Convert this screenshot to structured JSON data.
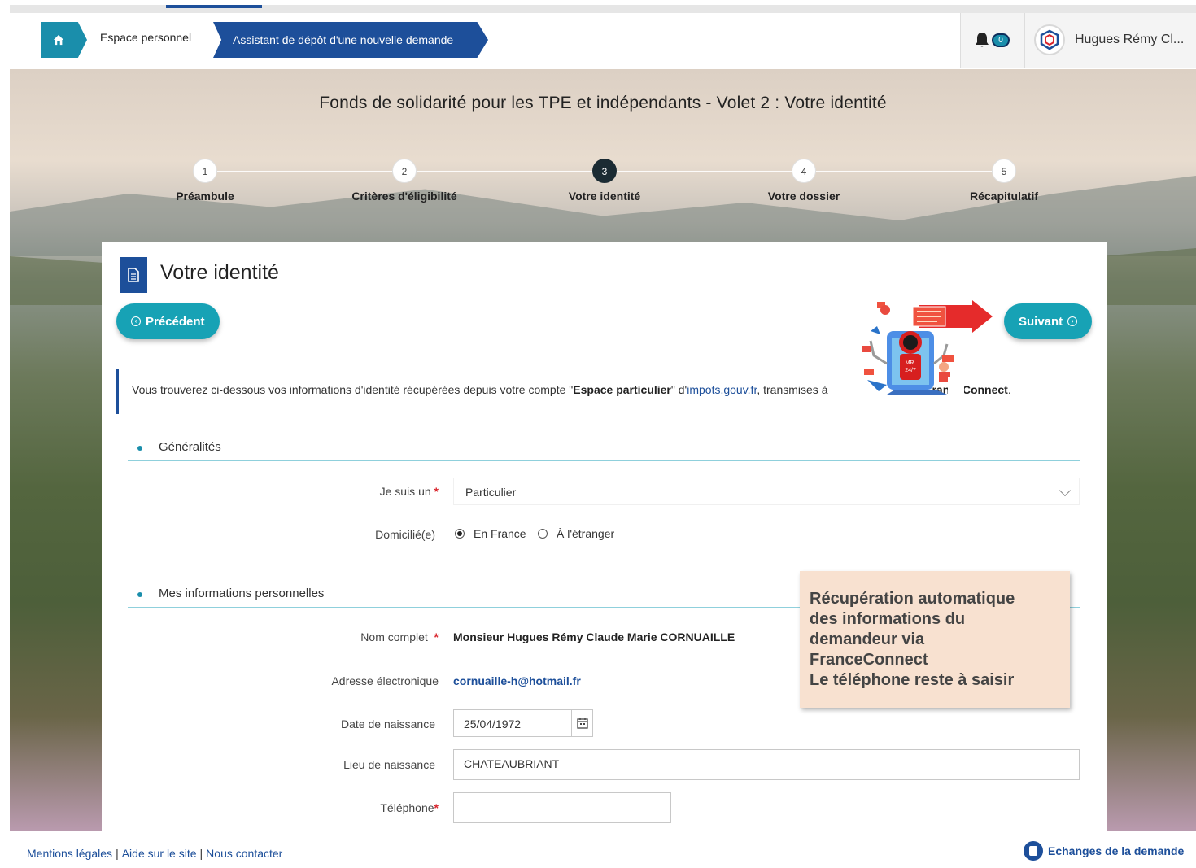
{
  "breadcrumb": {
    "home_icon": "home-icon",
    "personal_space": "Espace personnel",
    "wizard": "Assistant de dépôt d'une nouvelle demande"
  },
  "header": {
    "notification_count": "0",
    "user_name": "Hugues Rémy Cl..."
  },
  "page": {
    "title": "Fonds de solidarité pour les TPE et indépendants - Volet 2 : Votre identité"
  },
  "steps": [
    {
      "num": "1",
      "label": "Préambule"
    },
    {
      "num": "2",
      "label": "Critères d'éligibilité"
    },
    {
      "num": "3",
      "label": "Votre identité"
    },
    {
      "num": "4",
      "label": "Votre dossier"
    },
    {
      "num": "5",
      "label": "Récapitulatif"
    }
  ],
  "panel": {
    "title": "Votre identité",
    "prev_label": "Précédent",
    "next_label": "Suivant"
  },
  "info": {
    "t1": "Vous trouverez ci-dessous vos informations d'identité récupérées depuis votre compte \"",
    "b1": "Espace particulier",
    "t2": "\" d'",
    "link": "impots.gouv.fr",
    "t3": ", transmises à",
    "b2": "ranceConnect",
    "t4": "."
  },
  "sections": {
    "general": "Généralités",
    "personal": "Mes informations personnelles"
  },
  "form": {
    "type_label": "Je suis un",
    "type_value": "Particulier",
    "domicile_label": "Domicilié(e)",
    "domicile_options": [
      "En France",
      "À l'étranger"
    ],
    "name_label": "Nom complet",
    "name_value": "Monsieur Hugues Rémy Claude Marie CORNUAILLE",
    "email_label": "Adresse électronique",
    "email_value": "cornuaille-h@hotmail.fr",
    "dob_label": "Date de naissance",
    "dob_value": "25/04/1972",
    "pob_label": "Lieu de naissance",
    "pob_value": "CHATEAUBRIANT",
    "phone_label": "Téléphone",
    "phone_value": "",
    "required_mark": "*"
  },
  "callout": {
    "lines": [
      "Récupération automatique",
      "des informations du",
      "demandeur via",
      "FranceConnect",
      "Le téléphone reste à saisir"
    ]
  },
  "robot": {
    "badge_line1": "MR.",
    "badge_line2": "24/7"
  },
  "footer": {
    "links": [
      "Mentions légales",
      "Aide sur le site",
      "Nous contacter"
    ],
    "separator": "|",
    "exchanges": "Echanges de la demande"
  },
  "colors": {
    "primary_blue": "#1d4f9a",
    "teal": "#17a2b5",
    "callout_bg": "#f8e1d0",
    "required": "#d9262d"
  }
}
